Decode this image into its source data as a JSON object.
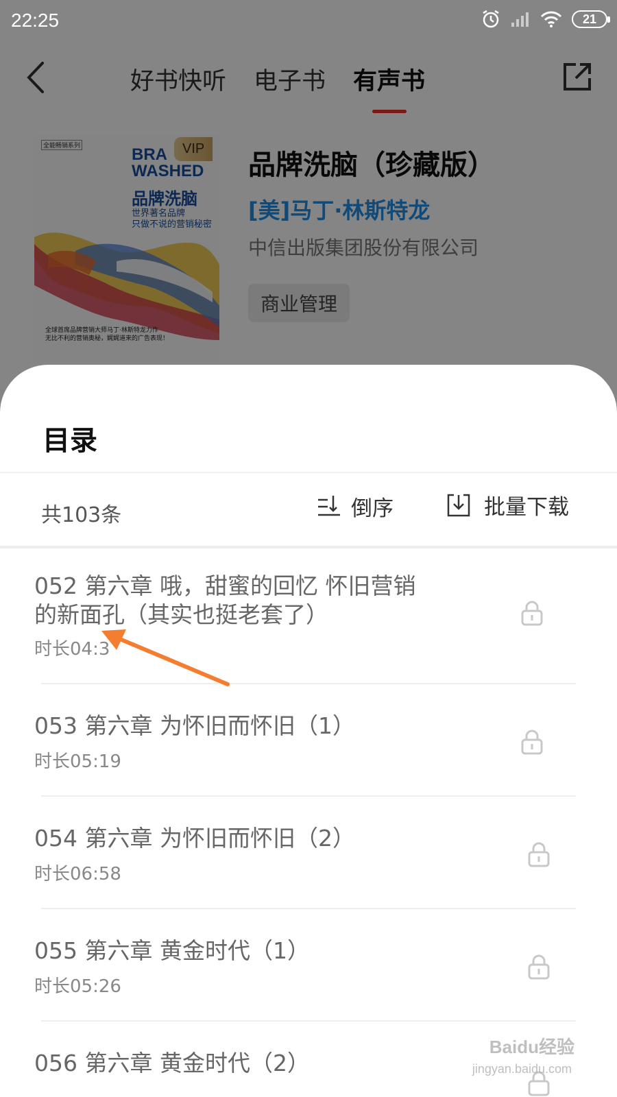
{
  "status": {
    "time": "22:25",
    "battery": "21"
  },
  "nav": {
    "tabs": [
      {
        "label": "好书快听"
      },
      {
        "label": "电子书"
      },
      {
        "label": "有声书"
      }
    ],
    "active_tab": "有声书"
  },
  "book": {
    "title": "品牌洗脑（珍藏版）",
    "author": "[美]马丁·林斯特龙",
    "publisher": "中信出版集团股份有限公司",
    "tag": "商业管理",
    "cover": {
      "series": "全能畅销系列",
      "en_title_line1": "BRA",
      "en_title_line2": "WASHED",
      "cn_title": "品牌洗脑",
      "cn_sub_line1": "世界著名品牌",
      "cn_sub_line2": "只做不说的营销秘密",
      "vip": "VIP",
      "foot_line1": "全球首席品牌营销大师马丁·林斯特龙力作",
      "foot_line2": "无比不利的营销奥秘，娓娓道来的广告表现！"
    }
  },
  "catalog": {
    "title": "目录",
    "count": "共103条",
    "sort_label": "倒序",
    "download_label": "批量下载",
    "items": [
      {
        "title": "052 第六章 哦，甜蜜的回忆 怀旧营销的新面孔（其实也挺老套了）",
        "duration": "时长04:3"
      },
      {
        "title": "053 第六章 为怀旧而怀旧（1）",
        "duration": "时长05:19"
      },
      {
        "title": "054 第六章 为怀旧而怀旧（2）",
        "duration": "时长06:58"
      },
      {
        "title": "055 第六章 黄金时代（1）",
        "duration": "时长05:26"
      },
      {
        "title": "056 第六章 黄金时代（2）",
        "duration": ""
      }
    ]
  },
  "watermark": {
    "main": "Baidu经验",
    "sub": "jingyan.baidu.com"
  },
  "colors": {
    "accent": "#e8322b",
    "author": "#1f8ee8",
    "arrow": "#f47d30"
  }
}
